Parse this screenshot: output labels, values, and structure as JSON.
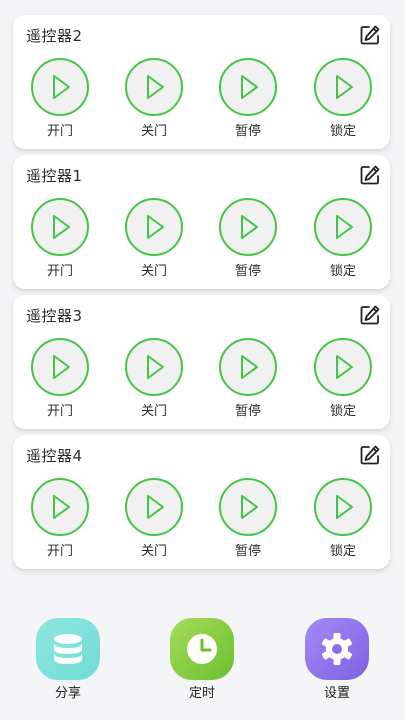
{
  "remotes": [
    {
      "title": "遥控器2",
      "buttons": [
        {
          "label": "开门",
          "icon": "play-icon"
        },
        {
          "label": "关门",
          "icon": "play-icon"
        },
        {
          "label": "暂停",
          "icon": "play-icon"
        },
        {
          "label": "锁定",
          "icon": "play-icon"
        }
      ]
    },
    {
      "title": "遥控器1",
      "buttons": [
        {
          "label": "开门",
          "icon": "play-icon"
        },
        {
          "label": "关门",
          "icon": "play-icon"
        },
        {
          "label": "暂停",
          "icon": "play-icon"
        },
        {
          "label": "锁定",
          "icon": "play-icon"
        }
      ]
    },
    {
      "title": "遥控器3",
      "buttons": [
        {
          "label": "开门",
          "icon": "play-icon"
        },
        {
          "label": "关门",
          "icon": "play-icon"
        },
        {
          "label": "暂停",
          "icon": "play-icon"
        },
        {
          "label": "锁定",
          "icon": "play-icon"
        }
      ]
    },
    {
      "title": "遥控器4",
      "buttons": [
        {
          "label": "开门",
          "icon": "play-icon"
        },
        {
          "label": "关门",
          "icon": "play-icon"
        },
        {
          "label": "暂停",
          "icon": "play-icon"
        },
        {
          "label": "锁定",
          "icon": "play-icon"
        }
      ]
    }
  ],
  "bottom_nav": [
    {
      "label": "分享",
      "icon": "database-icon",
      "color": "#6fdcd3"
    },
    {
      "label": "定时",
      "icon": "clock-icon",
      "color": "#7fcc3e"
    },
    {
      "label": "设置",
      "icon": "gear-icon",
      "color": "#8a6fe8"
    }
  ],
  "colors": {
    "accent_green": "#45c545",
    "card_bg": "#ffffff",
    "page_bg": "#f4f5f7"
  }
}
